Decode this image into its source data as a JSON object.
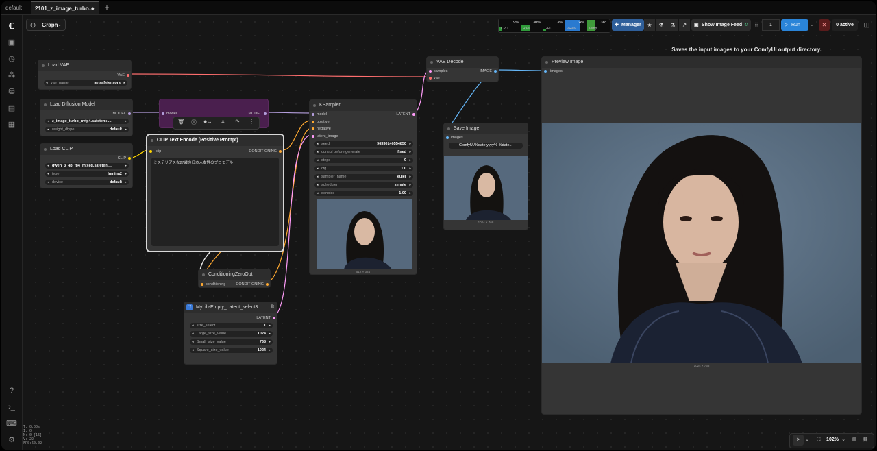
{
  "tabs": {
    "default": "default",
    "workflow": "2101_z_image_turbo...",
    "modified_dot": "●",
    "add": "+"
  },
  "toolbar": {
    "graph_label": "Graph",
    "monitors": [
      {
        "label": "CPU",
        "value": "9%"
      },
      {
        "label": "RAM",
        "value": "30%"
      },
      {
        "label": "GPU",
        "value": "3%"
      },
      {
        "label": "VRAM",
        "value": "74%"
      },
      {
        "label": "Temp",
        "value": "38°"
      }
    ],
    "manager": "Manager",
    "show_feed": "Show Image Feed",
    "queue_count": "1",
    "run": "Run",
    "active": "0 active"
  },
  "stats": [
    "T: 0.00s",
    "I: 0",
    "N: 0 [15]",
    "V: 22",
    "FPS:60.02"
  ],
  "tooltip": "Saves the input images to your ComfyUI output directory.",
  "nodes": {
    "load_vae": {
      "title": "Load VAE",
      "out": "VAE",
      "widget_label": "vae_name",
      "widget_value": "ae.safetensors"
    },
    "load_diffusion": {
      "title": "Load Diffusion Model",
      "out": "MODEL",
      "w1_value": "z_image_turbo_nvfp4.safetens ...",
      "w2_label": "weight_dtype",
      "w2_value": "default"
    },
    "load_clip": {
      "title": "Load CLIP",
      "out": "CLIP",
      "w1_value": "qwen_3_4b_fp4_mixed.safeten ...",
      "w2_label": "type",
      "w2_value": "lumina2",
      "w3_label": "device",
      "w3_value": "default"
    },
    "model_sampling": {
      "in": "model",
      "out": "MODEL"
    },
    "clip_encode": {
      "title": "CLIP Text Encode (Positive Prompt)",
      "in": "clip",
      "out": "CONDITIONING",
      "text": "ミステリアスな27歳の日本人女性のプロモデル"
    },
    "cond_zero": {
      "title": "ConditioningZeroOut",
      "in": "conditioning",
      "out": "CONDITIONING"
    },
    "ksampler": {
      "title": "KSampler",
      "inputs": [
        "model",
        "positive",
        "negative",
        "latent_image"
      ],
      "out": "LATENT",
      "widgets": [
        {
          "label": "seed",
          "value": "963301405548​50"
        },
        {
          "label": "control before generate",
          "value": "fixed"
        },
        {
          "label": "steps",
          "value": "9"
        },
        {
          "label": "cfg",
          "value": "1.0"
        },
        {
          "label": "sampler_name",
          "value": "euler"
        },
        {
          "label": "scheduler",
          "value": "simple"
        },
        {
          "label": "denoise",
          "value": "1.00"
        }
      ],
      "dims": "512 × 384"
    },
    "vae_decode": {
      "title": "VAE Decode",
      "in1": "samples",
      "in2": "vae",
      "out": "IMAGE"
    },
    "save_image": {
      "title": "Save Image",
      "in": "images",
      "prefix": "ComfyUI/%date:yyyy%-%date...",
      "dims": "1024 × 768"
    },
    "preview_image": {
      "title": "Preview Image",
      "in": "images",
      "dims": "1024 × 768"
    },
    "latent_select": {
      "title": "MyLib-Empty_Latent_select3",
      "out": "LATENT",
      "widgets": [
        {
          "label": "size_select",
          "value": "1"
        },
        {
          "label": "Large_size_value",
          "value": "1024"
        },
        {
          "label": "Small_size_value",
          "value": "768"
        },
        {
          "label": "Square_size_value",
          "value": "1024"
        }
      ]
    }
  },
  "zoom": {
    "value": "102%"
  },
  "colors": {
    "vae": "#ff6e6e",
    "model": "#b39ddb",
    "clip": "#ffd500",
    "conditioning": "#ffa931",
    "latent": "#ff9cf9",
    "image": "#64b5f6"
  }
}
